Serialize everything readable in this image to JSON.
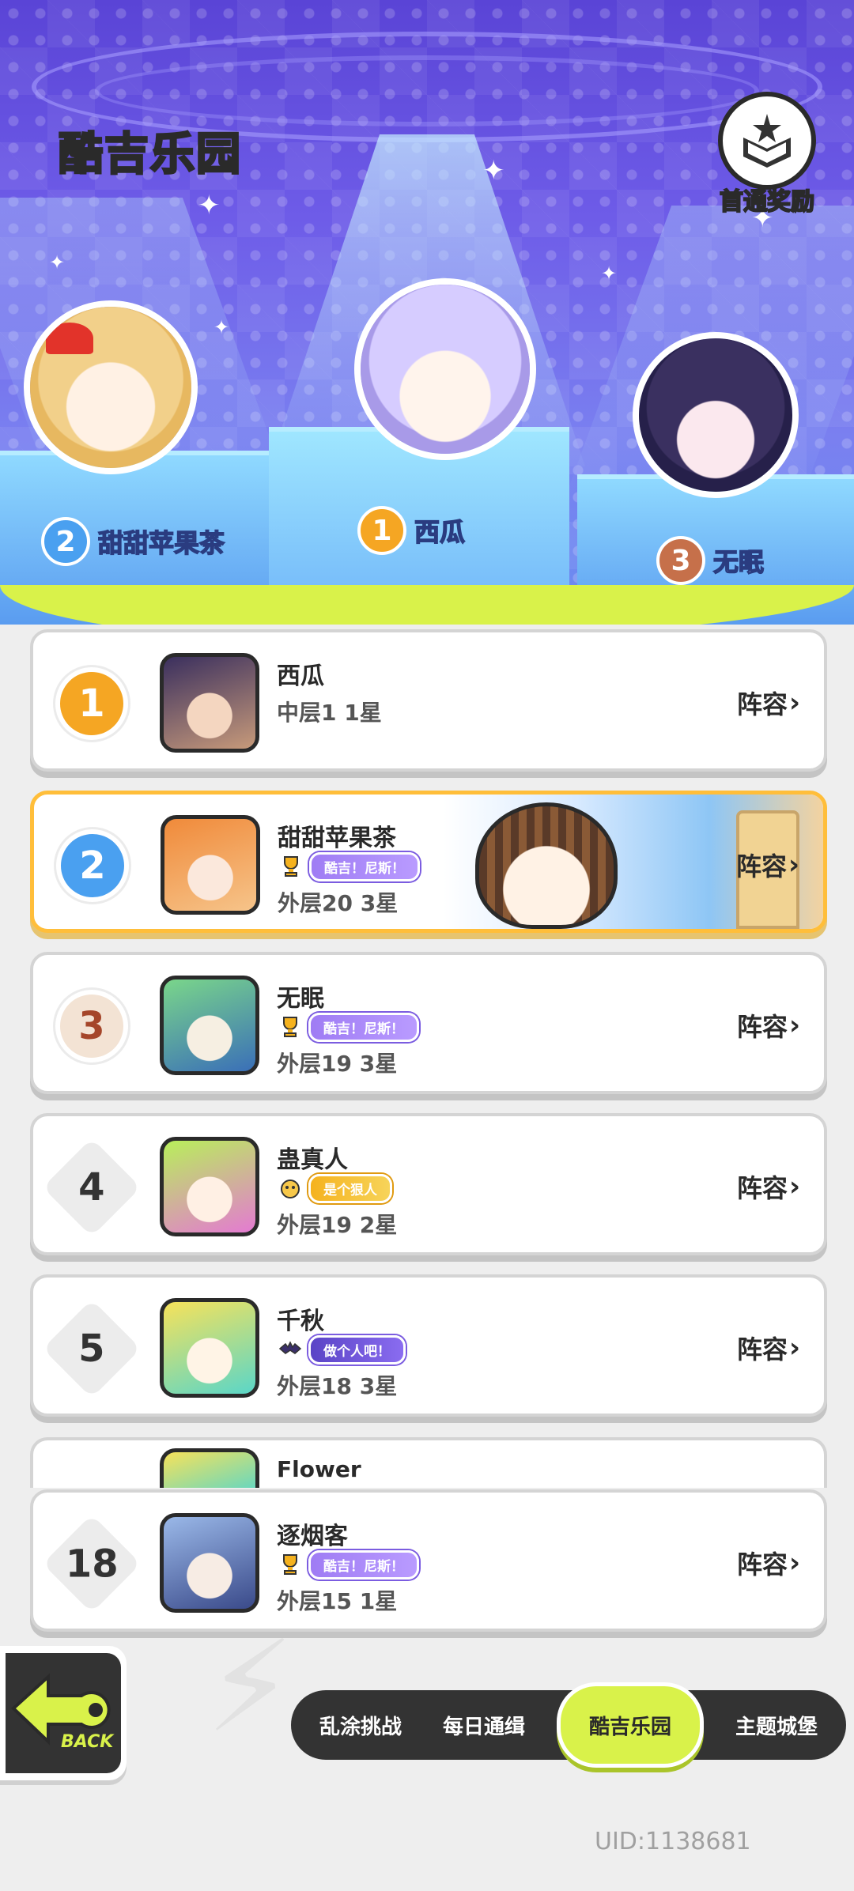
{
  "header": {
    "title": "酷吉乐园",
    "reward_label": "首通奖励",
    "reward_icon": "chest-icon"
  },
  "podium": [
    {
      "rank": "1",
      "name": "西瓜"
    },
    {
      "rank": "2",
      "name": "甜甜苹果茶"
    },
    {
      "rank": "3",
      "name": "无眠"
    }
  ],
  "leaderboard": [
    {
      "rank": "1",
      "name": "西瓜",
      "title": "",
      "score": "中层1 1星",
      "lineup": "阵容"
    },
    {
      "rank": "2",
      "name": "甜甜苹果茶",
      "title": "酷吉！尼斯！",
      "score": "外层20 3星",
      "lineup": "阵容"
    },
    {
      "rank": "3",
      "name": "无眠",
      "title": "酷吉！尼斯！",
      "score": "外层19 3星",
      "lineup": "阵容"
    },
    {
      "rank": "4",
      "name": "蛊真人",
      "title": "是个狠人",
      "score": "外层19 2星",
      "lineup": "阵容"
    },
    {
      "rank": "5",
      "name": "千秋",
      "title": "做个人吧！",
      "score": "外层18 3星",
      "lineup": "阵容"
    }
  ],
  "partial_row": {
    "name": "Flower"
  },
  "my_entry": {
    "rank": "18",
    "name": "逐烟客",
    "title": "酷吉！尼斯！",
    "score": "外层15 1星",
    "lineup": "阵容"
  },
  "back_label": "BACK",
  "nav_tabs": [
    {
      "label": "乱涂挑战",
      "active": false
    },
    {
      "label": "每日通缉",
      "active": false
    },
    {
      "label": "酷吉乐园",
      "active": true
    },
    {
      "label": "主题城堡",
      "active": false
    }
  ],
  "uid": "UID:1138681",
  "colors": {
    "accent": "#d9f24a",
    "gold": "#ffbe3a",
    "hero_bg": "#6e5ce8",
    "dark": "#333333"
  }
}
